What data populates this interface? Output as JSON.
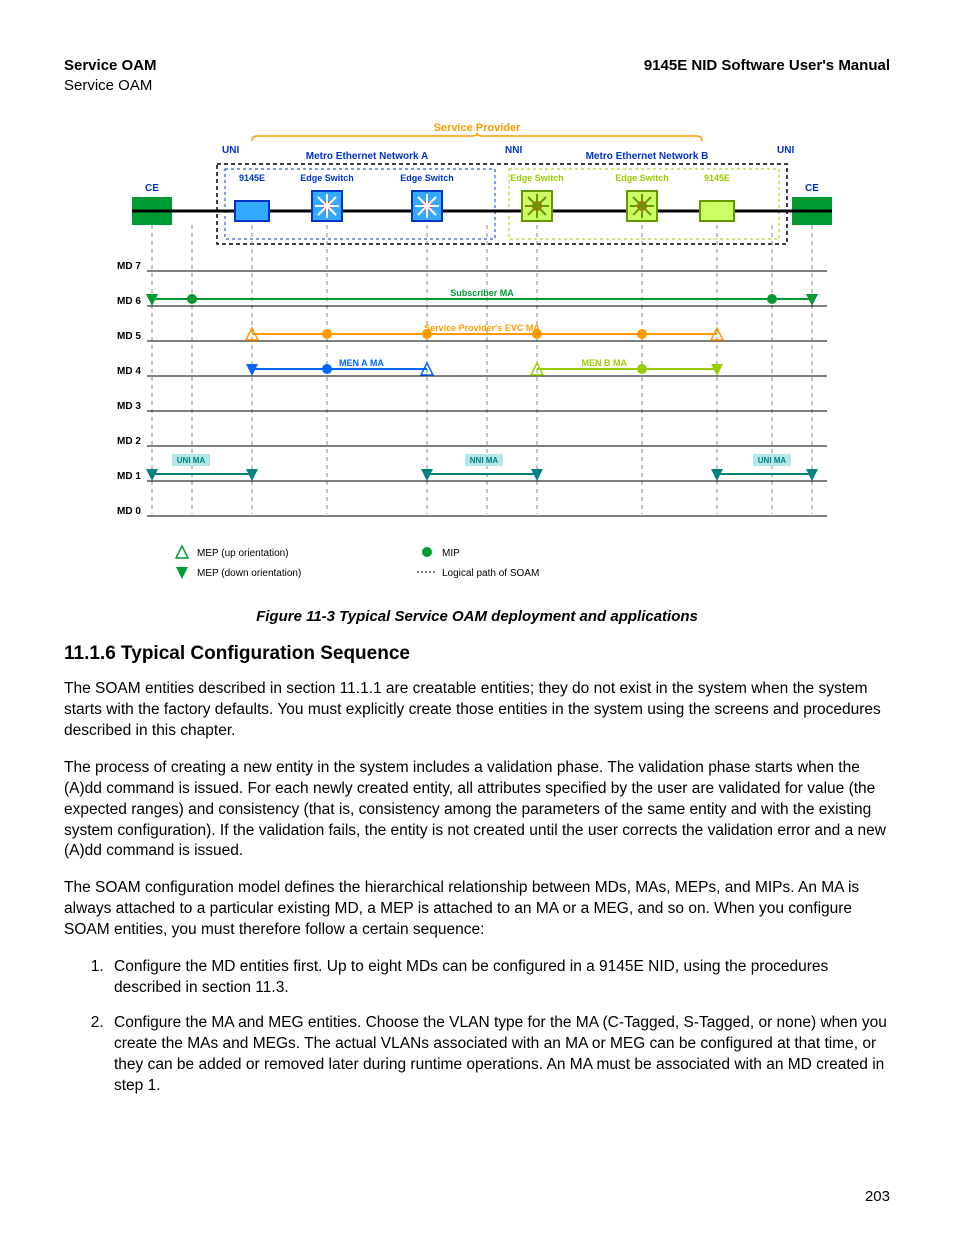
{
  "header": {
    "left_bold": "Service OAM",
    "left_plain": "Service OAM",
    "right_bold": "9145E NID Software User's Manual"
  },
  "figure": {
    "caption": "Figure 11-3  Typical Service OAM deployment and applications",
    "top_labels": {
      "service_provider": "Service Provider",
      "uni_left": "UNI",
      "nni": "NNI",
      "uni_right": "UNI",
      "men_a": "Metro Ethernet Network A",
      "men_b": "Metro Ethernet Network B",
      "ce_left": "CE",
      "ce_right": "CE",
      "dev_9145e_l": "9145E",
      "edge_a1": "Edge Switch",
      "edge_a2": "Edge Switch",
      "edge_b1": "Edge Switch",
      "edge_b2": "Edge Switch",
      "dev_9145e_r": "9145E"
    },
    "md_rows": [
      "MD 7",
      "MD 6",
      "MD 5",
      "MD 4",
      "MD 3",
      "MD 2",
      "MD 1",
      "MD 0"
    ],
    "ma_labels": {
      "subscriber": "Subscriber MA",
      "sp_evc": "Service Provider's EVC MA",
      "men_a_ma": "MEN A MA",
      "men_b_ma": "MEN B MA",
      "uni_ma_l": "UNI MA",
      "nni_ma": "NNI MA",
      "uni_ma_r": "UNI MA"
    },
    "legend": {
      "mep_up": "MEP (up orientation)",
      "mep_down": "MEP (down orientation)",
      "mip": "MIP",
      "logical_path": "Logical path of SOAM"
    }
  },
  "section": {
    "heading": "11.1.6  Typical Configuration Sequence",
    "p1": "The SOAM entities described in section 11.1.1 are creatable entities; they do not exist in the system when the system starts with the factory defaults. You must explicitly create those entities in the system using the screens and procedures described in this chapter.",
    "p2": "The process of creating a new entity in the system includes a validation phase. The validation phase starts when the (A)dd command is issued. For each newly created entity, all attributes specified by the user are validated for value (the expected ranges) and consistency (that is, consistency among the parameters of the same entity and with the existing system configuration). If the validation fails, the entity is not created until the user corrects the validation error and a new (A)dd command is issued.",
    "p3": "The SOAM configuration model defines the hierarchical relationship between MDs, MAs, MEPs, and MIPs. An MA is always attached to a particular existing MD, a MEP is attached to an MA or a MEG, and so on. When you configure SOAM entities, you must therefore follow a certain sequence:",
    "li1": "Configure the MD entities first. Up to eight MDs can be configured in a 9145E NID, using the procedures described in section 11.3.",
    "li2": "Configure the MA and MEG entities. Choose the VLAN type for the MA (C-Tagged, S-Tagged, or none) when you create the MAs and MEGs. The actual VLANs associated with an MA or MEG can be configured at that time, or they can be added or removed later during runtime operations. An MA must be associated with an MD created in step 1."
  },
  "page_number": "203"
}
